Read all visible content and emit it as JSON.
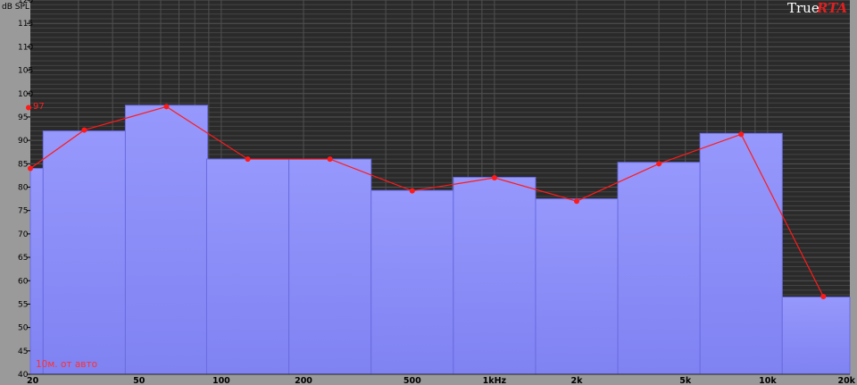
{
  "brand": {
    "true_text": "True",
    "rta_text": "RTA"
  },
  "annotations": {
    "peak": "97",
    "note": "10м. от авто"
  },
  "colors": {
    "bar_fill": "#8a8cf8",
    "bar_edge": "#6a6ce0",
    "line": "#ff1a1a",
    "plot_bg": "#2a2a2a",
    "grid": "#4a4a4a"
  },
  "chart_data": {
    "type": "bar",
    "ylabel": "dB SPL",
    "ylim": [
      40,
      120
    ],
    "xscale": "log",
    "xlim": [
      20,
      20000
    ],
    "grid": true,
    "y_ticks": [
      40,
      45,
      50,
      55,
      60,
      65,
      70,
      75,
      80,
      85,
      90,
      95,
      100,
      105,
      110,
      115,
      120
    ],
    "y_tick_labels": [
      "40",
      "45",
      "50",
      "55",
      "60",
      "65",
      "70",
      "75",
      "80",
      "85",
      "90",
      "95",
      "100",
      "105",
      "110",
      "115",
      "120"
    ],
    "x_ticks": [
      {
        "label": "20",
        "value": 20
      },
      {
        "label": "50",
        "value": 50
      },
      {
        "label": "100",
        "value": 100
      },
      {
        "label": "200",
        "value": 200
      },
      {
        "label": "500",
        "value": 500
      },
      {
        "label": "1kHz",
        "value": 1000
      },
      {
        "label": "2k",
        "value": 2000
      },
      {
        "label": "5k",
        "value": 5000
      },
      {
        "label": "10k",
        "value": 10000
      },
      {
        "label": "20k",
        "value": 20000
      }
    ],
    "bands": [
      {
        "center": 31.5,
        "value": 92
      },
      {
        "center": 63,
        "value": 97.5
      },
      {
        "center": 125,
        "value": 86
      },
      {
        "center": 250,
        "value": 86
      },
      {
        "center": 500,
        "value": 79.3
      },
      {
        "center": 1000,
        "value": 82.1
      },
      {
        "center": 2000,
        "value": 77.5
      },
      {
        "center": 4000,
        "value": 85.3
      },
      {
        "center": 8000,
        "value": 91.5
      },
      {
        "center": 16000,
        "value": 56.5
      }
    ],
    "edge_band": {
      "value": 84
    },
    "line_points": [
      {
        "x": 20,
        "y": 84
      },
      {
        "x": 31.5,
        "y": 92.2
      },
      {
        "x": 63,
        "y": 97.2
      },
      {
        "x": 125,
        "y": 86
      },
      {
        "x": 250,
        "y": 86
      },
      {
        "x": 500,
        "y": 79.2
      },
      {
        "x": 1000,
        "y": 82
      },
      {
        "x": 2000,
        "y": 77
      },
      {
        "x": 4000,
        "y": 85
      },
      {
        "x": 8000,
        "y": 91.3
      },
      {
        "x": 16000,
        "y": 56.6
      }
    ],
    "peak_marker": {
      "y": 97
    }
  }
}
